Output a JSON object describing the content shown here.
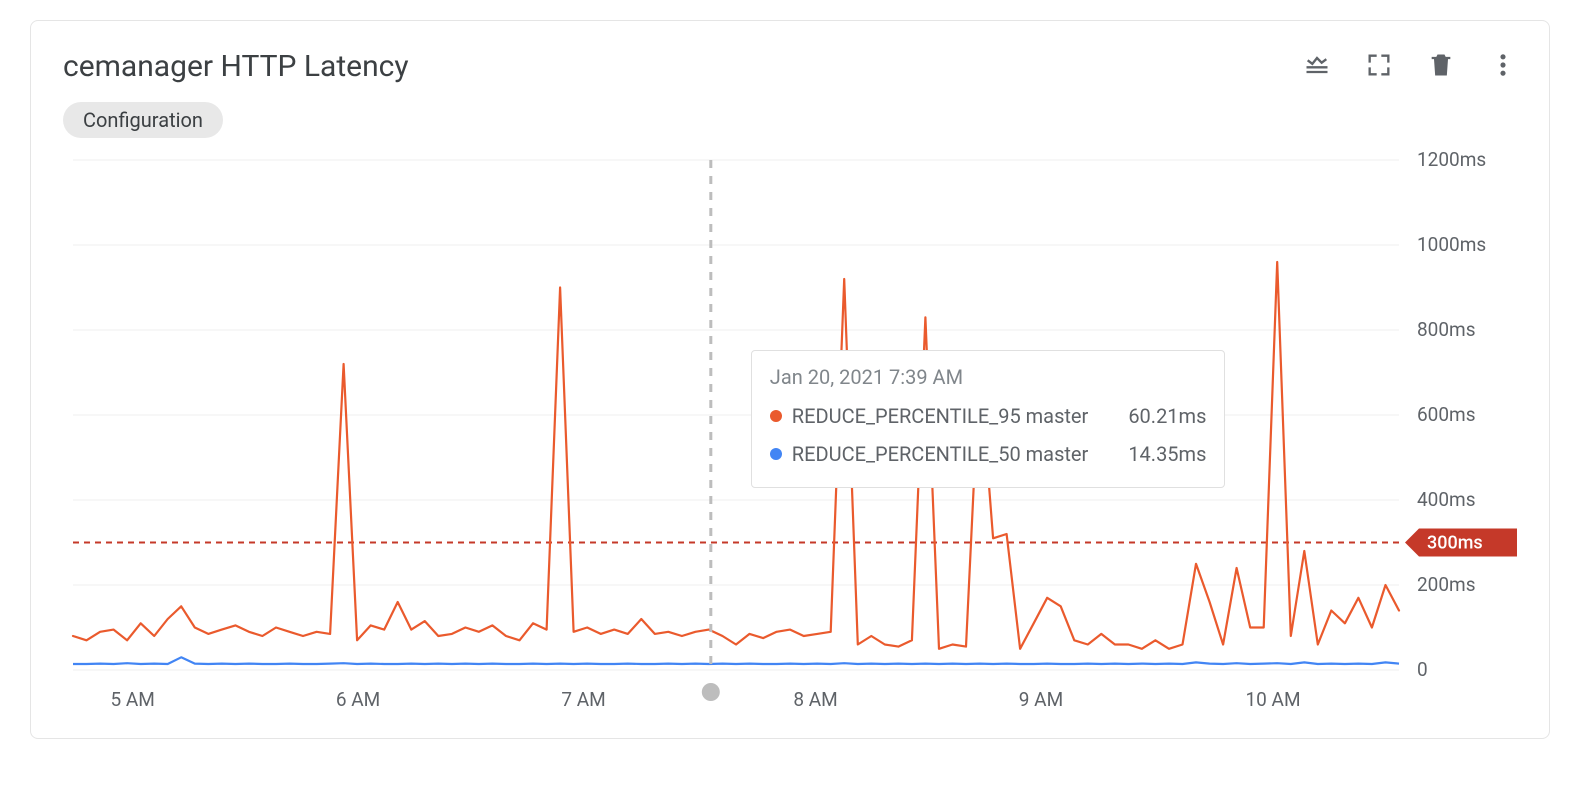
{
  "header": {
    "title": "cemanager HTTP Latency",
    "config_chip": "Configuration"
  },
  "chart_data": {
    "type": "line",
    "ylabel_unit": "ms",
    "ylim": [
      0,
      1200
    ],
    "y_ticks": [
      0,
      200,
      400,
      600,
      800,
      1000,
      1200
    ],
    "y_tick_labels": [
      "0",
      "200ms",
      "400ms",
      "600ms",
      "800ms",
      "1000ms",
      "1200ms"
    ],
    "x_tick_labels": [
      "5 AM",
      "6 AM",
      "7 AM",
      "8 AM",
      "9 AM",
      "10 AM"
    ],
    "threshold": {
      "value": 300,
      "label": "300ms"
    },
    "cursor": {
      "time_label": "Jan 20, 2021 7:39 AM",
      "x_fraction": 0.481
    },
    "series": [
      {
        "name": "REDUCE_PERCENTILE_95 master",
        "color": "#ea5a2d",
        "tooltip_value": "60.21ms",
        "values": [
          80,
          70,
          90,
          95,
          70,
          110,
          80,
          120,
          150,
          100,
          85,
          95,
          105,
          90,
          80,
          100,
          90,
          80,
          90,
          85,
          720,
          70,
          105,
          95,
          160,
          95,
          115,
          80,
          85,
          100,
          90,
          105,
          80,
          70,
          110,
          95,
          900,
          90,
          100,
          85,
          95,
          85,
          120,
          85,
          90,
          80,
          90,
          95,
          80,
          60,
          85,
          75,
          90,
          95,
          80,
          85,
          90,
          920,
          60,
          80,
          60,
          55,
          70,
          830,
          50,
          60,
          55,
          720,
          310,
          320,
          50,
          110,
          170,
          150,
          70,
          60,
          85,
          60,
          60,
          50,
          70,
          50,
          60,
          250,
          160,
          60,
          240,
          100,
          100,
          960,
          80,
          280,
          60,
          140,
          110,
          170,
          100,
          200,
          140
        ]
      },
      {
        "name": "REDUCE_PERCENTILE_50 master",
        "color": "#4285f4",
        "tooltip_value": "14.35ms",
        "values": [
          14,
          14,
          15,
          14,
          16,
          14,
          15,
          14,
          30,
          15,
          14,
          15,
          14,
          15,
          14,
          14,
          15,
          14,
          14,
          15,
          16,
          14,
          15,
          14,
          14,
          15,
          14,
          15,
          14,
          15,
          14,
          15,
          14,
          14,
          15,
          14,
          15,
          14,
          15,
          14,
          14,
          15,
          14,
          14,
          15,
          14,
          15,
          14,
          15,
          14,
          15,
          14,
          14,
          15,
          14,
          15,
          14,
          16,
          14,
          15,
          14,
          15,
          14,
          15,
          14,
          15,
          14,
          15,
          14,
          15,
          14,
          14,
          15,
          14,
          14,
          15,
          14,
          15,
          14,
          15,
          14,
          15,
          14,
          18,
          15,
          14,
          16,
          14,
          15,
          16,
          14,
          18,
          14,
          15,
          14,
          15,
          14,
          18,
          15
        ]
      }
    ]
  }
}
